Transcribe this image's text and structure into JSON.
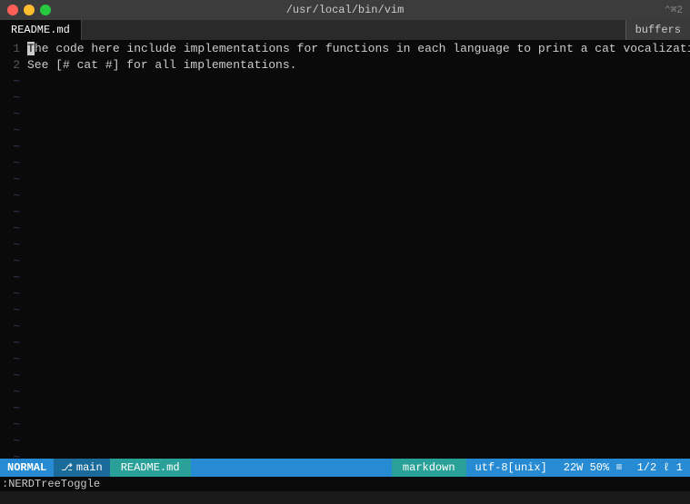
{
  "titleBar": {
    "title": "/usr/local/bin/vim",
    "shortcut": "⌃⌘2"
  },
  "tabBar": {
    "activeTab": "README.md",
    "buffersLabel": "buffers"
  },
  "editor": {
    "lines": [
      {
        "number": "1",
        "cursor": "T",
        "content": "he code here include implementations for functions in each language to print a cat vocalization."
      },
      {
        "number": "2",
        "content": "See [# cat #] for all implementations."
      }
    ],
    "tildes": 26
  },
  "statusBar": {
    "mode": "NORMAL",
    "gitIcon": "⎇",
    "branch": "main",
    "filename": "README.md",
    "filetype": "markdown",
    "encoding": "utf-8[unix]",
    "words": "22W",
    "percent": "50%",
    "lines": "≡",
    "position": "1/2",
    "columnSep": "ℓ",
    "column": "1"
  },
  "cmdLine": {
    "text": ":NERDTreeToggle"
  }
}
